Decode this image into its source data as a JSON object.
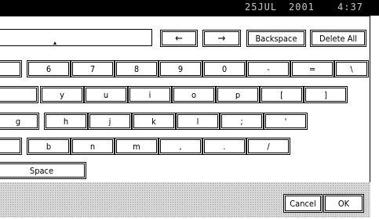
{
  "status_bar": {
    "date": "25JUL",
    "year": "2001",
    "time": "4:37"
  },
  "navigation": {
    "left_arrow": "←",
    "right_arrow": "→"
  },
  "edit_keys": {
    "backspace": "Backspace",
    "delete_all": "Delete All"
  },
  "keyboard": {
    "row1": [
      "6",
      "7",
      "8",
      "9",
      "0",
      "-",
      "=",
      "\\"
    ],
    "row2": [
      "y",
      "u",
      "i",
      "o",
      "p",
      "[",
      "]"
    ],
    "row3": [
      "g",
      "h",
      "j",
      "k",
      "l",
      ";",
      "'"
    ],
    "row4": [
      "b",
      "n",
      "m",
      ",",
      ".",
      "/"
    ],
    "space": "Space"
  },
  "footer": {
    "cancel": "Cancel",
    "ok": "OK"
  }
}
